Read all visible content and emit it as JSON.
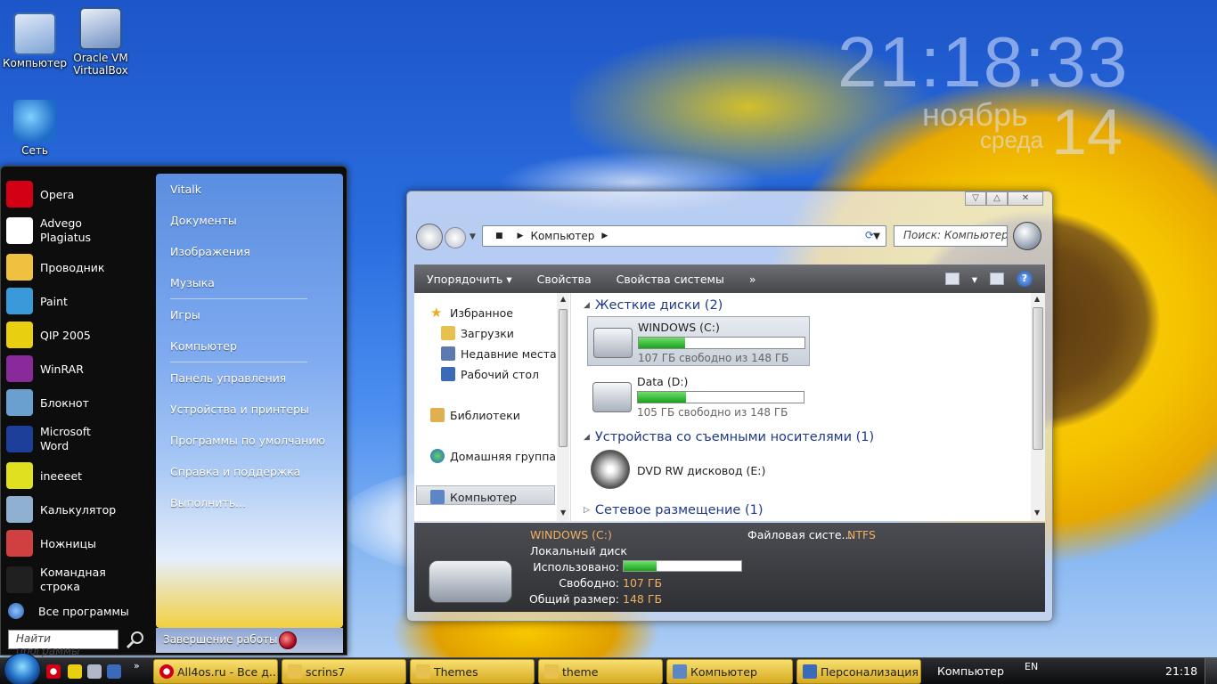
{
  "desktop": {
    "icons": [
      {
        "label": "Компьютер",
        "icon": "computer-icon"
      },
      {
        "label": "Oracle VM VirtualBox",
        "icon": "virtualbox-icon"
      },
      {
        "label": "Сеть",
        "icon": "network-icon"
      }
    ]
  },
  "clock_gadget": {
    "time": "21:18:33",
    "month": "ноябрь",
    "weekday": "среда",
    "date": "14"
  },
  "start_menu": {
    "left_items": [
      {
        "label": "Opera",
        "icon": "opera-icon",
        "color": "#d10014"
      },
      {
        "label": "Advego Plagiatus",
        "icon": "advego-icon",
        "color": "#ffffff"
      },
      {
        "label": "Проводник",
        "icon": "explorer-folder-icon",
        "color": "#f0c040"
      },
      {
        "label": "Paint",
        "icon": "paint-palette-icon",
        "color": "#3a9ad9"
      },
      {
        "label": "QIP 2005",
        "icon": "qip-flower-icon",
        "color": "#e8d010"
      },
      {
        "label": "WinRAR",
        "icon": "winrar-books-icon",
        "color": "#8a2a9a"
      },
      {
        "label": "Блокнот",
        "icon": "notepad-icon",
        "color": "#6aa0d0"
      },
      {
        "label": "Microsoft Word",
        "icon": "word-icon",
        "color": "#1d3f9a"
      },
      {
        "label": "ineeeet",
        "icon": "star-icon",
        "color": "#e0e020"
      },
      {
        "label": "Калькулятор",
        "icon": "calculator-icon",
        "color": "#8fb0d0"
      },
      {
        "label": "Ножницы",
        "icon": "scissors-icon",
        "color": "#d04040"
      },
      {
        "label": "Командная строка",
        "icon": "command-prompt-icon",
        "color": "#202020"
      }
    ],
    "all_programs": "Все программы",
    "search_placeholder": "Найти программы",
    "right_items": [
      {
        "label": "Vitalk"
      },
      {
        "label": "Документы"
      },
      {
        "label": "Изображения"
      },
      {
        "label": "Музыка"
      },
      {
        "label": "Игры"
      },
      {
        "label": "Компьютер"
      },
      {
        "label": "Панель управления"
      },
      {
        "label": "Устройства и принтеры"
      },
      {
        "label": "Программы по умолчанию"
      },
      {
        "label": "Справка и поддержка"
      },
      {
        "label": "Выполнить..."
      }
    ],
    "shutdown": "Завершение работы"
  },
  "explorer": {
    "address": "Компьютер",
    "search_placeholder": "Поиск: Компьютер",
    "toolbar": {
      "organize": "Упорядочить",
      "properties": "Свойства",
      "system_properties": "Свойства системы",
      "more": "»"
    },
    "nav": [
      {
        "label": "Избранное",
        "icon": "favorites-star-icon"
      },
      {
        "label": "Загрузки",
        "icon": "downloads-folder-icon"
      },
      {
        "label": "Недавние места",
        "icon": "recent-places-icon"
      },
      {
        "label": "Рабочий стол",
        "icon": "desktop-icon"
      },
      {
        "label": "Библиотеки",
        "icon": "libraries-icon"
      },
      {
        "label": "Домашняя группа",
        "icon": "homegroup-icon"
      },
      {
        "label": "Компьютер",
        "icon": "computer-icon"
      }
    ],
    "groups": {
      "hard_disks": "Жесткие диски (2)",
      "removable": "Устройства со съемными носителями (1)",
      "network": "Сетевое размещение (1)"
    },
    "drives": [
      {
        "name": "WINDOWS (C:)",
        "free_text": "107 ГБ свободно из 148 ГБ",
        "used_fraction": 0.277
      },
      {
        "name": "Data (D:)",
        "free_text": "105 ГБ свободно из 148 ГБ",
        "used_fraction": 0.29
      }
    ],
    "dvd": {
      "name": "DVD RW дисковод (E:)"
    },
    "details": {
      "title": "WINDOWS (C:)",
      "type": "Локальный диск",
      "used_label": "Использовано:",
      "free_label": "Свободно:",
      "free_value": "107 ГБ",
      "total_label": "Общий размер:",
      "total_value": "148 ГБ",
      "fs_label": "Файловая систе...",
      "fs_value": "NTFS",
      "used_fraction": 0.277
    }
  },
  "taskbar": {
    "buttons": [
      {
        "label": "All4os.ru - Все д...",
        "icon": "opera-icon"
      },
      {
        "label": "scrins7",
        "icon": "folder-icon"
      },
      {
        "label": "Themes",
        "icon": "folder-icon"
      },
      {
        "label": "theme",
        "icon": "folder-icon"
      },
      {
        "label": "Компьютер",
        "icon": "computer-icon"
      },
      {
        "label": "Персонализация",
        "icon": "personalization-icon"
      }
    ],
    "toolbar_label": "Компьютер",
    "lang": "EN",
    "time": "21:18"
  },
  "watermark": "All4os.ru"
}
